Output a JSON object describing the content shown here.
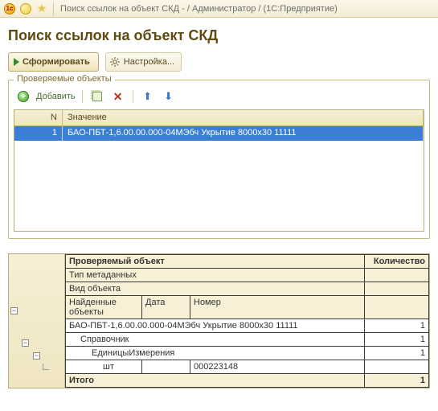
{
  "titlebar": {
    "text": "Поиск ссылок на объект СКД - / Администратор /  (1С:Предприятие)"
  },
  "page": {
    "title": "Поиск ссылок на объект СКД"
  },
  "toolbar": {
    "form_label": "Сформировать",
    "settings_label": "Настройка..."
  },
  "fieldset": {
    "legend": "Проверяемые объекты",
    "add_label": "Добавить"
  },
  "grid1": {
    "head_n": "N",
    "head_value": "Значение",
    "rows": [
      {
        "n": "1",
        "value": "БАО-ПБТ-1,6.00.00.000-04МЭбч Укрытие 8000х30 11111"
      }
    ]
  },
  "report": {
    "h_obj": "Проверяемый объект",
    "h_qty": "Количество",
    "h_type": "Тип метаданных",
    "h_kind": "Вид объекта",
    "h_found": "Найденные объекты",
    "h_date": "Дата",
    "h_number": "Номер",
    "row_obj": "БАО-ПБТ-1,6.00.00.000-04МЭбч  Укрытие 8000х30 11111",
    "row_obj_qty": "1",
    "row_type": "Справочник",
    "row_type_qty": "1",
    "row_kind": "ЕдиницыИзмерения",
    "row_kind_qty": "1",
    "row_item": "шт",
    "row_item_num": "000223148",
    "total_label": "Итого",
    "total_qty": "1"
  }
}
